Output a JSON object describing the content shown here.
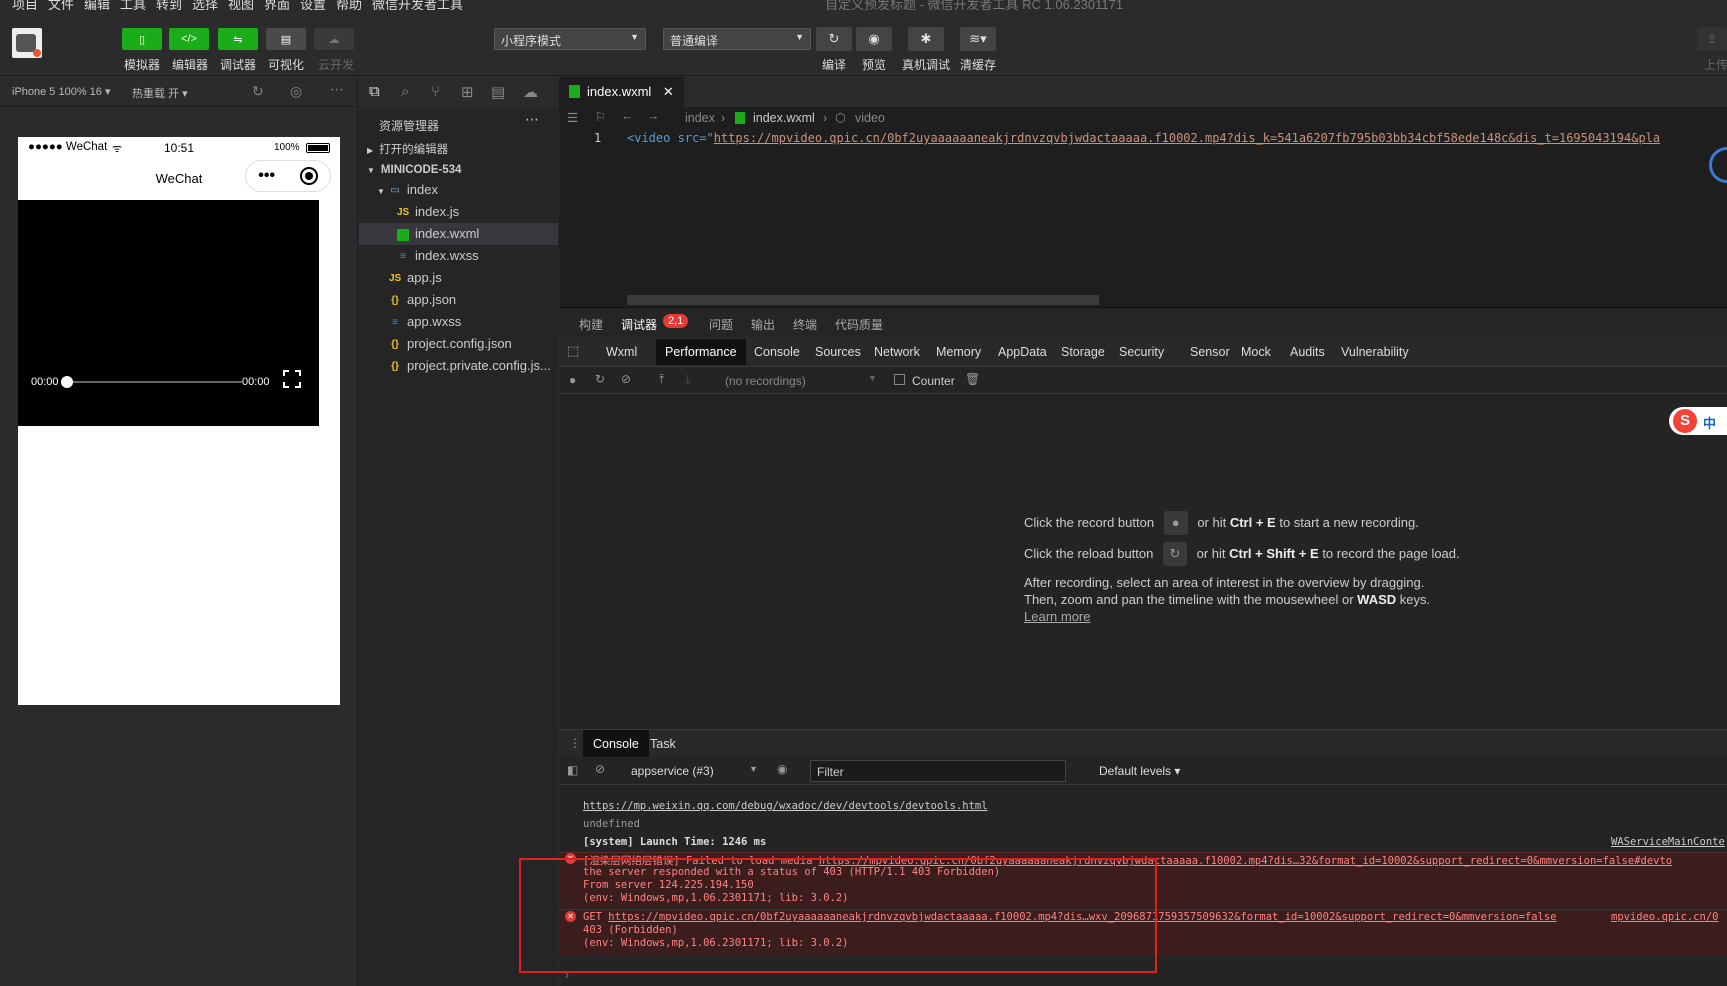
{
  "menu": [
    "项目",
    "文件",
    "编辑",
    "工具",
    "转到",
    "选择",
    "视图",
    "界面",
    "设置",
    "帮助",
    "微信开发者工具"
  ],
  "window_title": "自定义预发标题 - 微信开发者工具 RC 1.06.2301171",
  "toolbar": {
    "buttons": [
      {
        "label": "模拟器",
        "icon": "phone-icon"
      },
      {
        "label": "编辑器",
        "icon": "code-icon"
      },
      {
        "label": "调试器",
        "icon": "debug-icon"
      },
      {
        "label": "可视化",
        "icon": "layout-icon"
      },
      {
        "label": "云开发",
        "icon": "cloud-icon"
      }
    ],
    "mode_select": "小程序模式",
    "compile_select": "普通编译",
    "actions": [
      {
        "label": "编译",
        "icon": "refresh-icon"
      },
      {
        "label": "预览",
        "icon": "eye-icon"
      },
      {
        "label": "真机调试",
        "icon": "bug-icon"
      },
      {
        "label": "清缓存",
        "icon": "layers-icon"
      }
    ],
    "upload_label": "上传"
  },
  "simulator": {
    "device": "iPhone 5 100% 16",
    "hotreload": "热重载 开",
    "status_left": "●●●●● WeChat",
    "status_time": "10:51",
    "status_battery": "100%",
    "nav_title": "WeChat",
    "video_time_start": "00:00",
    "video_time_end": "00:00"
  },
  "explorer": {
    "title": "资源管理器",
    "open_editors": "打开的编辑器",
    "project": "MINICODE-534",
    "items": [
      {
        "name": "index",
        "type": "folder",
        "indent": 2
      },
      {
        "name": "index.js",
        "type": "js",
        "indent": 3
      },
      {
        "name": "index.wxml",
        "type": "wxml",
        "indent": 3,
        "selected": true
      },
      {
        "name": "index.wxss",
        "type": "wxss",
        "indent": 3
      },
      {
        "name": "app.js",
        "type": "js",
        "indent": 2
      },
      {
        "name": "app.json",
        "type": "json",
        "indent": 2
      },
      {
        "name": "app.wxss",
        "type": "wxss",
        "indent": 2
      },
      {
        "name": "project.config.json",
        "type": "json",
        "indent": 2
      },
      {
        "name": "project.private.config.js...",
        "type": "json",
        "indent": 2
      }
    ]
  },
  "editor": {
    "tab": "index.wxml",
    "breadcrumb": [
      "index",
      "index.wxml",
      "video"
    ],
    "line_number": "1",
    "code_tag": "<video src=\"",
    "code_url": "https://mpvideo.qpic.cn/0bf2uyaaaaaaneakjrdnvzqvbjwdactaaaaa.f10002.mp4?dis_k=541a6207fb795b03bb34cbf58ede148c&dis_t=1695043194&pla"
  },
  "devtools": {
    "top_tabs": [
      "构建",
      "调试器",
      "问题",
      "输出",
      "终端",
      "代码质量"
    ],
    "debugger_badge": "2,1",
    "chrome_tabs": [
      "Wxml",
      "Performance",
      "Console",
      "Sources",
      "Network",
      "Memory",
      "AppData",
      "Storage",
      "Security",
      "Sensor",
      "Mock",
      "Audits",
      "Vulnerability"
    ],
    "recordings": "(no recordings)",
    "counter_label": "Counter",
    "help1_a": "Click the record button",
    "help1_b": "or hit ",
    "help1_keys": "Ctrl + E",
    "help1_c": " to start a new recording.",
    "help2_a": "Click the reload button",
    "help2_b": "or hit ",
    "help2_keys": "Ctrl + Shift + E",
    "help2_c": " to record the page load.",
    "help3": "After recording, select an area of interest in the overview by dragging.",
    "help4_a": "Then, zoom and pan the timeline with the mousewheel or ",
    "help4_keys": "WASD",
    "help4_b": " keys.",
    "learn_more": "Learn more",
    "console_tabs": [
      "Console",
      "Task"
    ],
    "context": "appservice (#3)",
    "filter_placeholder": "Filter",
    "levels": "Default levels",
    "log": {
      "devtools_link": "https://mp.weixin.qq.com/debug/wxadoc/dev/devtools/devtools.html",
      "undefined": "undefined",
      "launch": "[system] Launch Time: 1246 ms",
      "launch_src": "WAServiceMainConte",
      "err1_head": "[渲染层网络层错误] Failed to load media ",
      "err1_url": "https://mpvideo.qpic.cn/0bf2uyaaaaaaneakjrdnvzqvbjwdactaaaaa.f10002.mp4?dis…32&format_id=10002&support_redirect=0&mmversion=false#devto",
      "err1_l2": "the server responded with a status of 403 (HTTP/1.1 403 Forbidden)",
      "err1_l3": "From server 124.225.194.150",
      "err1_l4": "(env: Windows,mp,1.06.2301171; lib: 3.0.2)",
      "err2_head": "GET ",
      "err2_url": "https://mpvideo.qpic.cn/0bf2uyaaaaaaneakjrdnvzqvbjwdactaaaaa.f10002.mp4?dis…wxv_2096871759357509632&format_id=10002&support_redirect=0&mmversion=false",
      "err2_src": "mpvideo.qpic.cn/0",
      "err2_l2": "403 (Forbidden)",
      "err2_l3": "(env: Windows,mp,1.06.2301171; lib: 3.0.2)"
    }
  },
  "ime": "中"
}
